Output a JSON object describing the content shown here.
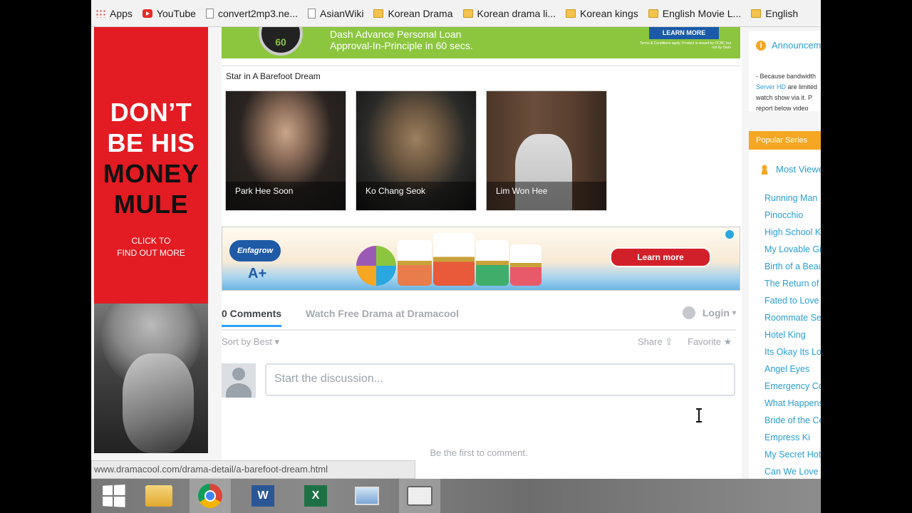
{
  "bookmarks": [
    {
      "label": "Apps",
      "icon": "apps-grid-icon"
    },
    {
      "label": "YouTube",
      "icon": "youtube-icon"
    },
    {
      "label": "convert2mp3.ne...",
      "icon": "page-icon"
    },
    {
      "label": "AsianWiki",
      "icon": "page-icon"
    },
    {
      "label": "Korean Drama",
      "icon": "folder-icon"
    },
    {
      "label": "Korean drama li...",
      "icon": "folder-icon"
    },
    {
      "label": "Korean kings",
      "icon": "folder-icon"
    },
    {
      "label": "English Movie L...",
      "icon": "folder-icon"
    },
    {
      "label": "English",
      "icon": "folder-icon"
    }
  ],
  "left_ad": {
    "line1": "DON’T",
    "line2": "BE HIS",
    "line3": "MONEY",
    "line4": "MULE",
    "cta1": "CLICK TO",
    "cta2": "FIND OUT MORE",
    "color": "#e31b23"
  },
  "top_banner": {
    "badge": "60",
    "line1": "Dash Advance Personal Loan",
    "line2": "Approval-In-Principle in 60 secs.",
    "button": "LEARN MORE",
    "fine_print": "Terms & Conditions apply. Product is issued by OCBC but not by Dash"
  },
  "stars_section": {
    "title": "Star in A Barefoot Dream",
    "items": [
      {
        "name": "Park Hee Soon"
      },
      {
        "name": "Ko Chang Seok"
      },
      {
        "name": "Lim Won Hee"
      }
    ]
  },
  "mid_ad": {
    "brand": "Enfagrow",
    "badge": "A+",
    "cta": "Learn more"
  },
  "comments": {
    "count_tab": "0 Comments",
    "site_tab": "Watch Free Drama at Dramacool",
    "login": "Login",
    "sort": "Sort by Best",
    "share": "Share",
    "favorite": "Favorite",
    "placeholder": "Start the discussion...",
    "empty": "Be the first to comment."
  },
  "sidebar": {
    "announce_title": "Announcement",
    "announce_line1": "- Because bandwidth",
    "announce_link": "Server HD",
    "announce_line2_rest": " are limited",
    "announce_line3": "watch show via it. P",
    "announce_line4": "report below video",
    "popular_header": "Popular Series",
    "most_viewed": "Most Viewed",
    "series": [
      "Running Man",
      "Pinocchio",
      "High School King",
      "My Lovable Girl",
      "Birth of a Beauty",
      "The Return of",
      "Fated to Love",
      "Roommate Season",
      "Hotel King",
      "Its Okay Its Love",
      "Angel Eyes",
      "Emergency Couple",
      "What Happens",
      "Bride of the Century",
      "Empress Ki",
      "My Secret Hotel",
      "Can We Love"
    ]
  },
  "status_bar": "www.dramacool.com/drama-detail/a-barefoot-dream.html",
  "taskbar": [
    "windows-start-icon",
    "file-explorer-icon",
    "chrome-icon",
    "word-icon",
    "excel-icon",
    "app-icon",
    "camera-app-icon"
  ]
}
